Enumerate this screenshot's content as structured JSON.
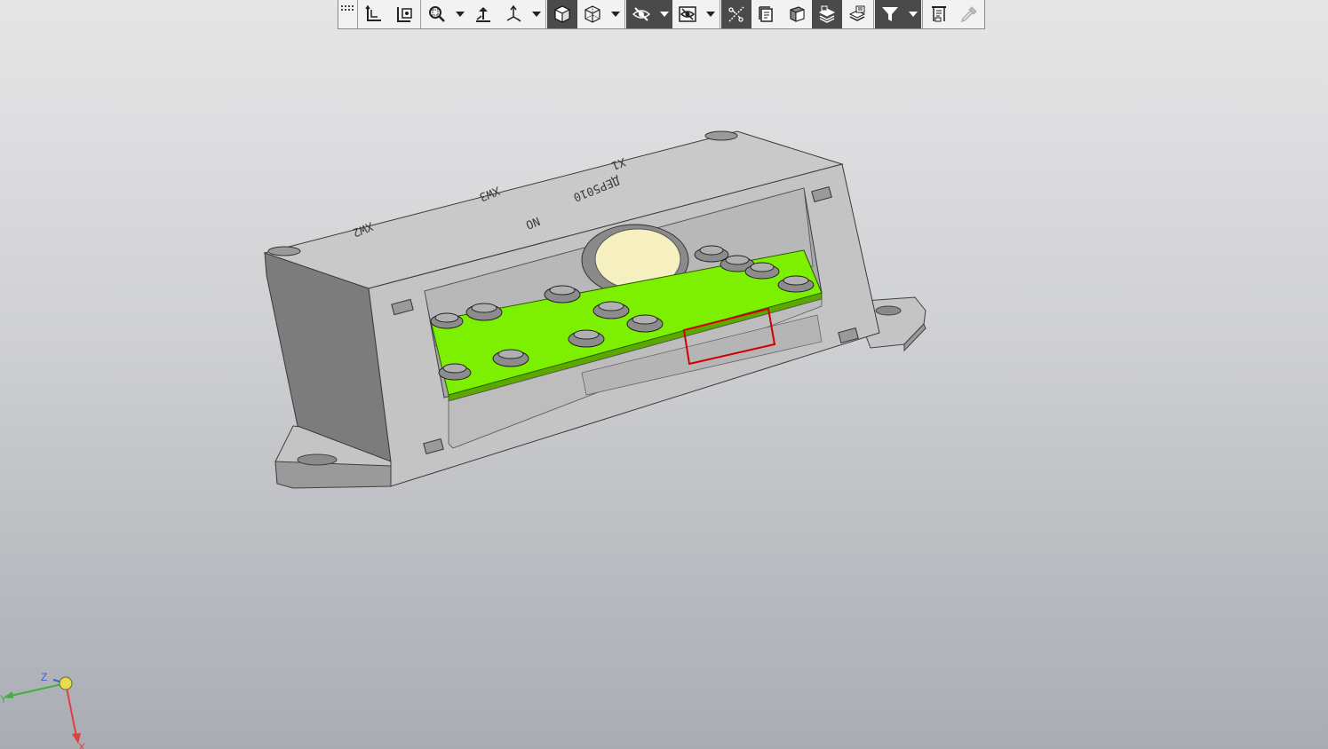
{
  "toolbar": {
    "buttons": [
      {
        "name": "toolbar-grip",
        "icon": "grip-dots-icon"
      },
      {
        "name": "orientation-button",
        "icon": "orientation-icon"
      },
      {
        "name": "normal-to-button",
        "icon": "normal-to-icon"
      },
      {
        "name": "zoom-button",
        "icon": "zoom-icon",
        "dropdown": true
      },
      {
        "name": "pan-button",
        "icon": "pan-icon"
      },
      {
        "name": "rotate-button",
        "icon": "rotate-icon",
        "dropdown": true
      },
      {
        "name": "shaded-view-button",
        "icon": "shaded-cube-icon",
        "active": true
      },
      {
        "name": "wireframe-view-button",
        "icon": "wireframe-cube-icon",
        "dropdown": true
      },
      {
        "name": "hide-button",
        "icon": "hide-eye-icon",
        "active": true,
        "dropdown": true
      },
      {
        "name": "show-only-button",
        "icon": "show-only-icon",
        "dropdown": true
      },
      {
        "name": "section-button",
        "icon": "section-icon",
        "active": true
      },
      {
        "name": "sheet-button",
        "icon": "sheet-icon"
      },
      {
        "name": "cut-view-button",
        "icon": "cut-view-icon"
      },
      {
        "name": "layers-button",
        "icon": "layers-icon",
        "active": true
      },
      {
        "name": "layers-properties-button",
        "icon": "layers-properties-icon"
      },
      {
        "name": "filter-button",
        "icon": "filter-icon",
        "active": true,
        "dropdown": true
      },
      {
        "name": "measure-button",
        "icon": "measure-icon"
      },
      {
        "name": "eyedropper-button",
        "icon": "eyedropper-icon",
        "disabled": true
      }
    ]
  },
  "model": {
    "labels": {
      "xw2": "XW2",
      "xw3": "XW3",
      "x1": "X1",
      "part_number": "ДЕР5010",
      "sub": "NO"
    },
    "colors": {
      "housing": "#c8c8c8",
      "housing_dark": "#7a7a7a",
      "pcb": "#7cf000",
      "lamp": "#f6f0c0",
      "highlight": "#d00000"
    }
  },
  "axes": {
    "z_label": "Z",
    "y_label": "Y",
    "x_label": "X",
    "x_color": "#e04040",
    "y_color": "#40b040",
    "z_color": "#4060d0"
  }
}
